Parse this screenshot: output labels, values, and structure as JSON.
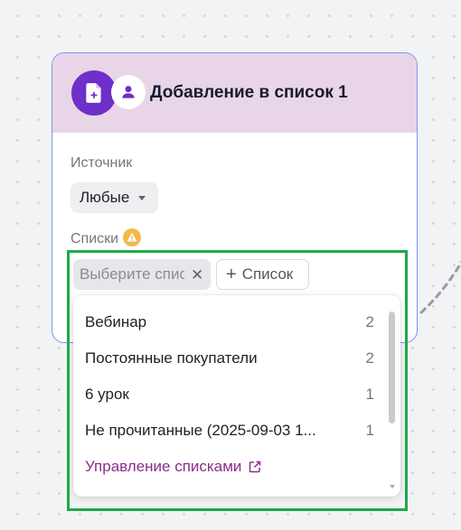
{
  "node": {
    "title": "Добавление в список 1",
    "icons": [
      "add-document-icon",
      "user-icon"
    ]
  },
  "source": {
    "label": "Источник",
    "selected": "Любые"
  },
  "lists": {
    "label": "Списки",
    "warning_icon": "warning-triangle-icon",
    "placeholder": "Выберите списки",
    "add_button_label": "Список",
    "dropdown": {
      "items": [
        {
          "label": "Вебинар",
          "count": "2"
        },
        {
          "label": "Постоянные покупатели",
          "count": "2"
        },
        {
          "label": "6 урок",
          "count": "1"
        },
        {
          "label": "Не прочитанные (2025-09-03 1...",
          "count": "1"
        }
      ],
      "manage_label": "Управление списками"
    }
  },
  "colors": {
    "accent_purple": "#6f2fc9",
    "header_bg": "#e8d6e8",
    "card_border": "#7b91f3",
    "manage_link": "#8b2e8b",
    "warning": "#f2b84b",
    "highlight": "#1fa84a"
  }
}
